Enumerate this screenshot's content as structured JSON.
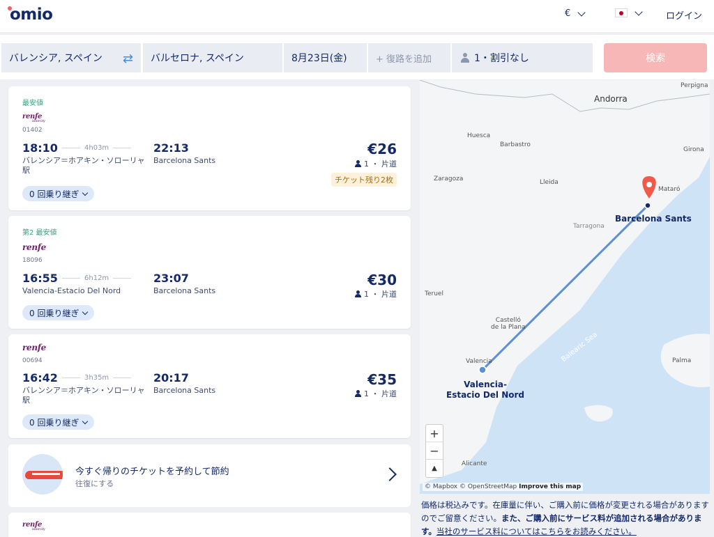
{
  "header": {
    "logo": "omio",
    "currency": "€",
    "login": "ログイン"
  },
  "search": {
    "from": "バレンシア, スペイン",
    "to": "バルセロナ, スペイン",
    "date": "8月23日(金)",
    "return_placeholder": "+ 復路を追加",
    "passengers": "1・割引なし",
    "search_button": "検索"
  },
  "results": [
    {
      "tag": "最安値",
      "operator": "renfe",
      "operator_sub": "intercity",
      "train_no": "01402",
      "depart": "18:10",
      "duration": "4h03m",
      "arrive": "22:13",
      "from_station": "バレンシア＝ホアキン・ソローリャ駅",
      "to_station": "Barcelona Sants",
      "price": "€26",
      "pax": "1 ・ 片道",
      "seats_left": "チケット残り2枚",
      "transfers": "0 回乗り継ぎ"
    },
    {
      "tag": "第2 最安値",
      "operator": "renfe",
      "train_no": "18096",
      "depart": "16:55",
      "duration": "6h12m",
      "arrive": "23:07",
      "from_station": "Valencia-Estacio Del Nord",
      "to_station": "Barcelona Sants",
      "price": "€30",
      "pax": "1 ・ 片道",
      "transfers": "0 回乗り継ぎ"
    },
    {
      "operator": "renfe",
      "train_no": "00694",
      "depart": "16:42",
      "duration": "3h35m",
      "arrive": "20:17",
      "from_station": "バレンシア＝ホアキン・ソローリャ駅",
      "to_station": "Barcelona Sants",
      "price": "€35",
      "pax": "1 ・ 片道",
      "transfers": "0 回乗り継ぎ"
    }
  ],
  "promo": {
    "title": "今すぐ帰りのチケットを予約して節約",
    "subtitle": "往復にする"
  },
  "next_card": {
    "operator": "renfe",
    "operator_sub": "intercity"
  },
  "map": {
    "cities": {
      "andorra": "Andorra",
      "perpignan": "Perpigna",
      "huesca": "Huesca",
      "barbastro": "Barbastro",
      "girona": "Girona",
      "zaragoza": "Zaragoza",
      "lleida": "Lleida",
      "mataro": "Mataró",
      "tarragona": "Tarragona",
      "teruel": "Teruel",
      "castello_1": "Castelló",
      "castello_2": "de la Plana",
      "valencia": "Valencia",
      "sea": "Balearic Sea",
      "palma": "Palma",
      "alicante": "Alicante"
    },
    "destination_label": "Barcelona Sants",
    "origin_label_1": "Valencia-",
    "origin_label_2": "Estacio Del Nord",
    "zoom_in": "+",
    "zoom_out": "−",
    "compass": "▲",
    "attribution": "© Mapbox © OpenStreetMap",
    "improve": "Improve this map"
  },
  "notice": {
    "part1": "価格は税込みです。在庫量に伴い、ご購入前に価格が変更される場合がありますのでご留意ください。",
    "part2": "また、ご購入前にサービス料が追加される場合があります。",
    "link": "当社のサービス料についてはこちらをお読みください。"
  },
  "colors": {
    "brand": "#132968",
    "accent_red": "#fc5c65",
    "search_disabled": "#f7b7b7",
    "route_line": "#5b8fd6",
    "sea": "#cfe3f7"
  }
}
